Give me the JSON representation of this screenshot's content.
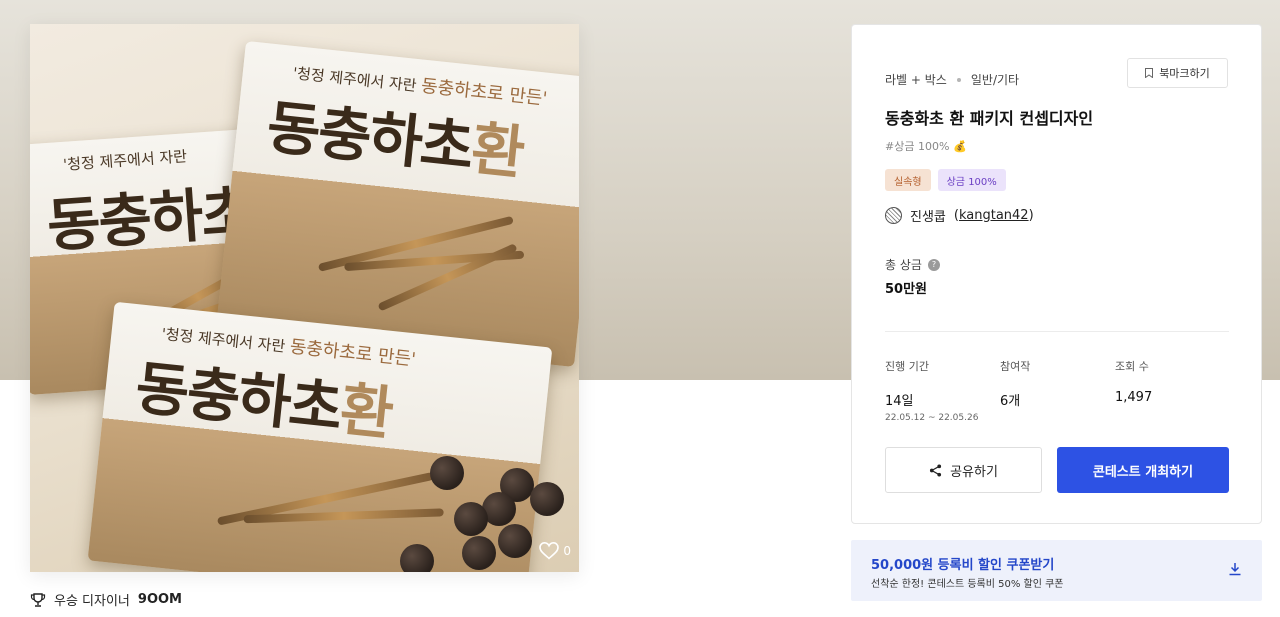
{
  "product": {
    "pouch_title": "동충하초",
    "pouch_title_accent": "환",
    "pouch_subtitle": "'청정 제주에서 자란",
    "pouch_subtitle_accent": "동충하초로 만든'",
    "like_count": "0"
  },
  "winner": {
    "label": "우승 디자이너",
    "name": "9OOM"
  },
  "card": {
    "category": "라벨 + 박스",
    "subcategory": "일반/기타",
    "bookmark_label": "북마크하기",
    "title": "동충화초 환 패키지 컨셉디자인",
    "tagline": "#상금 100%",
    "tagline_emoji": "💰",
    "badges": [
      "실속형",
      "상금 100%"
    ],
    "host_name": "진생쿱",
    "host_handle": "kangtan42",
    "prize_label": "총 상금",
    "prize_help": "?",
    "prize_value": "50만원",
    "stats": [
      {
        "label": "진행 기간",
        "value": "14일",
        "sub": "22.05.12 ~ 22.05.26"
      },
      {
        "label": "참여작",
        "value": "6개",
        "sub": ""
      },
      {
        "label": "조회 수",
        "value": "1,497",
        "sub": ""
      }
    ],
    "share_label": "공유하기",
    "host_button_label": "콘테스트 개최하기"
  },
  "coupon": {
    "title": "50,000원 등록비 할인 쿠폰받기",
    "description": "선착순 한정! 콘테스트 등록비 50% 할인 쿠폰"
  },
  "colors": {
    "primary": "#2d52e4",
    "coupon_bg": "#eef1fb",
    "coupon_text": "#2447c9",
    "badge_orange_bg": "#f6e2d3",
    "badge_purple_bg": "#ebe3fb"
  }
}
